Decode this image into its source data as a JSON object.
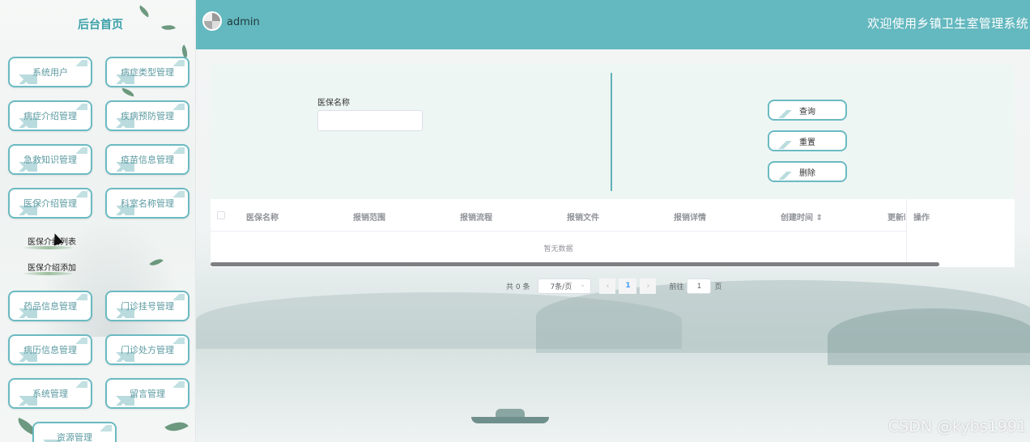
{
  "sidebar": {
    "home_title": "后台首页",
    "menu": [
      {
        "id": "system-user",
        "label": "系统用户"
      },
      {
        "id": "disease-type",
        "label": "病症类型管理"
      },
      {
        "id": "disease-intro",
        "label": "病症介绍管理"
      },
      {
        "id": "disease-prevention",
        "label": "疾病预防管理"
      },
      {
        "id": "first-aid",
        "label": "急救知识管理"
      },
      {
        "id": "vaccine",
        "label": "疫苗信息管理"
      },
      {
        "id": "insurance-intro",
        "label": "医保介绍管理"
      },
      {
        "id": "department",
        "label": "科室名称管理"
      }
    ],
    "submenu": [
      {
        "label": "医保介绍列表"
      },
      {
        "label": "医保介绍添加"
      }
    ],
    "menu2": [
      {
        "label": "药品信息管理"
      },
      {
        "label": "门诊挂号管理"
      },
      {
        "label": "病历信息管理"
      },
      {
        "label": "门诊处方管理"
      },
      {
        "label": "系统管理"
      },
      {
        "label": "留言管理"
      },
      {
        "label": "资源管理"
      }
    ]
  },
  "header": {
    "username": "admin",
    "site_title": "欢迎使用乡镇卫生室管理系统"
  },
  "search": {
    "field_label": "医保名称",
    "field_value": "",
    "buttons": {
      "query": "查询",
      "reset": "重置",
      "delete": "删除"
    }
  },
  "table": {
    "columns": [
      "医保名称",
      "报销范围",
      "报销流程",
      "报销文件",
      "报销详情",
      "创建时间",
      "更新时"
    ],
    "sort_icon": "⇕",
    "ops_header": "操作",
    "empty_text": "暂无数据"
  },
  "pagination": {
    "total": "共 0 条",
    "page_size": "7条/页",
    "prev": "‹",
    "current_page": "1",
    "next": "›",
    "goto_label": "前往",
    "goto_value": "1",
    "page_suffix": "页"
  },
  "watermark": "CSDN @kybs1991"
}
